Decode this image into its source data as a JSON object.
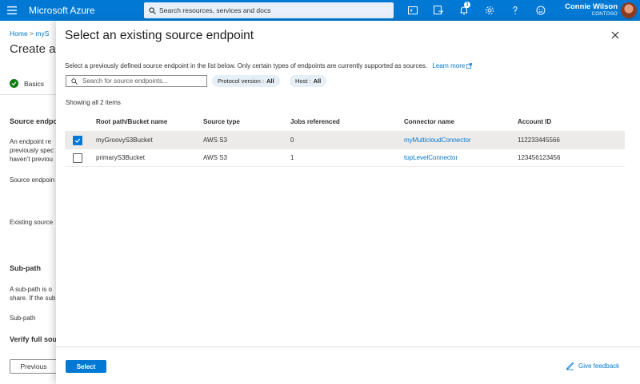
{
  "topbar": {
    "brand": "Microsoft Azure",
    "search_placeholder": "Search resources, services and docs",
    "notification_count": "1",
    "icons": [
      "cloud-shell-icon",
      "directory-filter-icon",
      "notifications-icon",
      "settings-icon",
      "help-icon",
      "feedback-icon"
    ],
    "user_name": "Connie Wilson",
    "user_org": "CONTOSO",
    "accent": "#0078d4"
  },
  "background_page": {
    "breadcrumb_home": "Home",
    "breadcrumb_sep": ">",
    "breadcrumb_item": "myS",
    "title": "Create a",
    "step_basics": "Basics",
    "step_partial": "(",
    "source_heading": "Source endpo",
    "desc_lines": [
      "An endpoint re",
      "previously spec",
      "haven't previou"
    ],
    "source_endpoint_label": "Source endpoin",
    "existing_source_label": "Existing source",
    "subpath_heading": "Sub-path",
    "subpath_desc_lines": [
      "A sub-path is o",
      "share. If the sub"
    ],
    "subpath_label": "Sub-path",
    "verify_heading": "Verify full sou",
    "previous_button": "Previous"
  },
  "panel": {
    "title": "Select an existing source endpoint",
    "description": "Select a previously defined source endpoint in the list below. Only certain types of endpoints are currently supported as sources.",
    "learn_more": "Learn more",
    "filter_placeholder": "Search for source endpoints...",
    "pills": [
      {
        "label": "Protocol version :",
        "value": "All"
      },
      {
        "label": "Host :",
        "value": "All"
      }
    ],
    "count_text": "Showing all 2 items",
    "columns": [
      "Root path/Bucket name",
      "Source type",
      "Jobs referenced",
      "Connector name",
      "Account ID"
    ],
    "rows": [
      {
        "selected": true,
        "name": "myGroovyS3Bucket",
        "type": "AWS S3",
        "jobs": "0",
        "connector": "myMulticloudConnector",
        "account": "112233445566"
      },
      {
        "selected": false,
        "name": "primaryS3Bucket",
        "type": "AWS S3",
        "jobs": "1",
        "connector": "topLevelConnector",
        "account": "123456123456"
      }
    ],
    "select_button": "Select",
    "give_feedback": "Give feedback"
  }
}
